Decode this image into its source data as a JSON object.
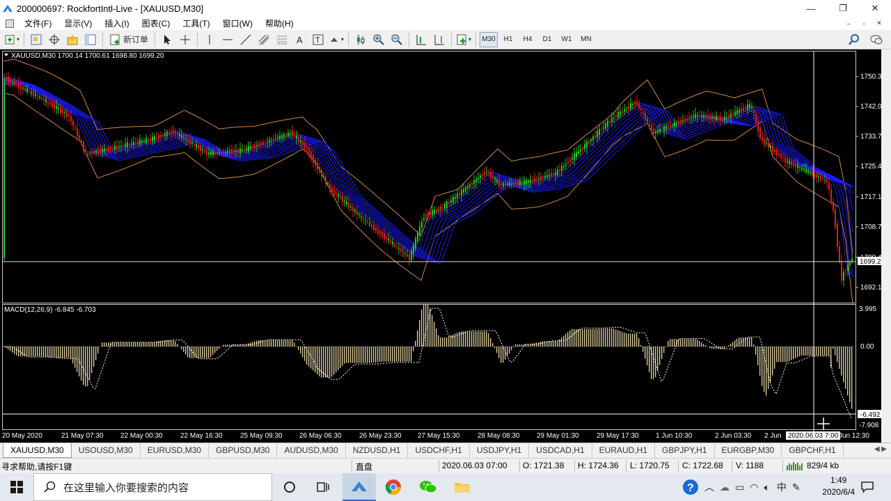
{
  "window": {
    "title": "200000697: RockfortIntl-Live - [XAUUSD,M30]",
    "minimize": "—",
    "maximize": "❐",
    "close": "✕"
  },
  "menu": [
    "文件(F)",
    "显示(V)",
    "插入(I)",
    "图表(C)",
    "工具(T)",
    "窗口(W)",
    "帮助(H)"
  ],
  "mdi_buttons": [
    "–",
    "▫",
    "✕"
  ],
  "toolbar": {
    "new_order_label": "新订单",
    "timeframes": [
      "M30",
      "H1",
      "H4",
      "D1",
      "W1",
      "MN"
    ],
    "active_timeframe": "M30"
  },
  "chart": {
    "header": "XAUUSD,M30  1700.14 1700.61 1698.80 1699.20",
    "price_ticks": [
      "1750.30",
      "1742.00",
      "1733.70",
      "1725.40",
      "1717.10",
      "1708.70",
      "1700.40",
      "1692.10"
    ],
    "current_price": "1699.20",
    "time_labels": [
      "20 May 2020",
      "21 May 07:30",
      "22 May 00:30",
      "22 May 16:30",
      "25 May 09:30",
      "26 May 06:30",
      "26 May 23:30",
      "27 May 15:30",
      "28 May 08:30",
      "29 May 01:30",
      "29 May 17:30",
      "1 Jun 10:30",
      "2 Jun 03:30",
      "2 Jun",
      "Jun 12:30"
    ],
    "crosshair_time": "2020.06.03 7:00",
    "macd": {
      "header": "MACD(12,26,9) -6.845 -6.703",
      "ticks": [
        "3.995",
        "0.00",
        "-7.908"
      ],
      "crosshair_value": "-6.492"
    },
    "colors": {
      "background": "#000000",
      "bull_candle": "#22cc22",
      "bear_candle": "#dd2020",
      "ma_ribbon": "#1a1aff",
      "bollinger": "#d4883a",
      "macd_hist": "#d8c89a",
      "macd_signal": "#ffffff"
    }
  },
  "symbol_tabs": [
    "XAUUSD,M30",
    "USOUSD,M30",
    "EURUSD,M30",
    "GBPUSD,M30",
    "AUDUSD,M30",
    "NZDUSD,H1",
    "USDCHF,H1",
    "USDJPY,H1",
    "USDCAD,H1",
    "EURAUD,H1",
    "GBPJPY,H1",
    "EURGBP,M30",
    "GBPCHF,H1"
  ],
  "active_symbol_tab": "XAUUSD,M30",
  "status": {
    "help": "寻求帮助,请按F1键",
    "profile": "直盘",
    "time": "2020.06.03 07:00",
    "open": "O: 1721.38",
    "high": "H: 1724.36",
    "low": "L: 1720.75",
    "close": "C: 1722.68",
    "volume": "V: 1188",
    "traffic": "829/4 kb"
  },
  "taskbar": {
    "search_placeholder": "在这里输入你要搜索的内容",
    "ime": "中",
    "time": "1:49",
    "date": "2020/6/4"
  }
}
